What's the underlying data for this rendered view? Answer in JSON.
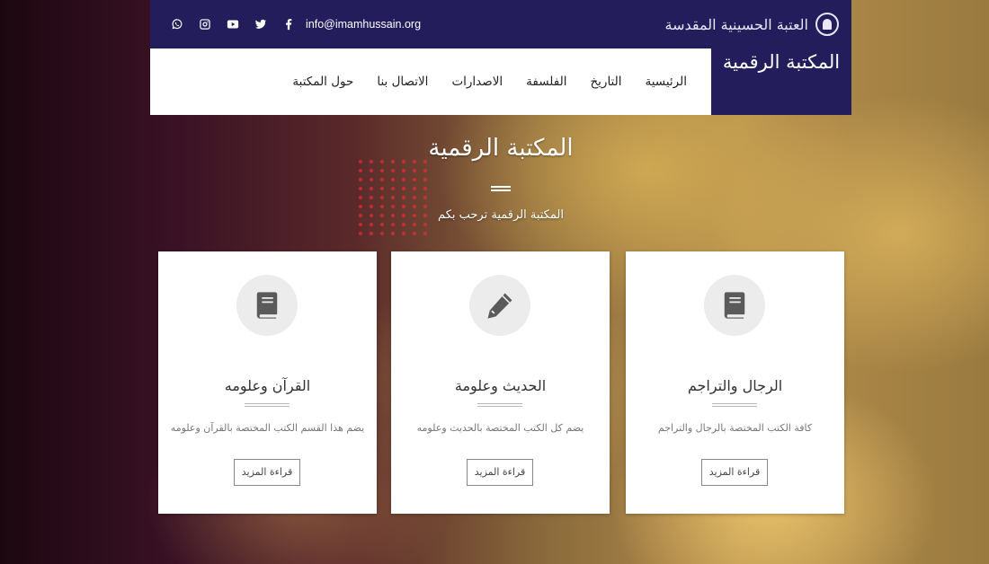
{
  "topbar": {
    "email": "info@imamhussain.org",
    "logo_text": "العتبة الحسينية المقدسة",
    "social_icons": [
      "viber-icon",
      "instagram-icon",
      "youtube-icon",
      "twitter-icon",
      "facebook-icon"
    ]
  },
  "brand": {
    "title": "المكتبة الرقمية"
  },
  "nav": {
    "items": [
      "الرئيسية",
      "التاريخ",
      "الفلسفة",
      "الاصدارات",
      "الاتصال بنا",
      "حول المكتبة"
    ]
  },
  "hero": {
    "title": "المكتبة الرقمية",
    "subtitle": "المكتبة الرقمية ترحب بكم"
  },
  "cards": [
    {
      "icon": "book-icon",
      "title": "القرآن وعلومه",
      "desc": "يضم هذا القسم الكتب المختصة بالقرآن وعلومه",
      "button": "قراءة المزيد"
    },
    {
      "icon": "pencil-icon",
      "title": "الحديث وعلومة",
      "desc": "يضم كل الكتب المختصة بالحديث وعلومه",
      "button": "قراءة المزيد"
    },
    {
      "icon": "book-icon",
      "title": "الرجال والتراجم",
      "desc": "كافة الكتب المختصة بالرجال والتراجم",
      "button": "قراءة المزيد"
    }
  ],
  "colors": {
    "primary": "#241d5c",
    "icon": "#5a5a5a"
  }
}
